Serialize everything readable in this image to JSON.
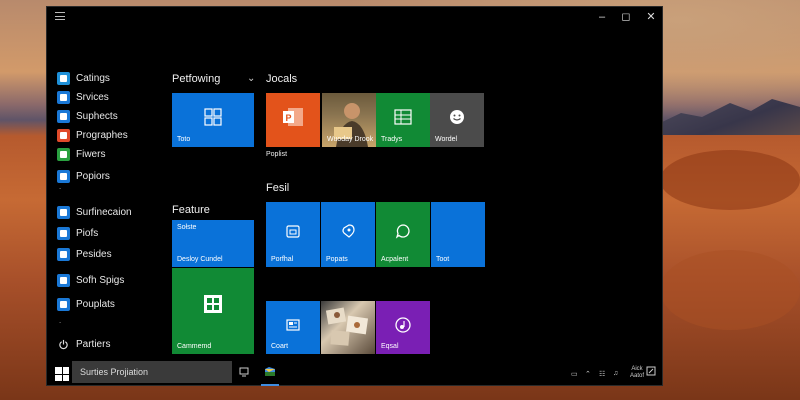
{
  "colors": {
    "tile_blue": "#0a72d9",
    "tile_orange": "#e3531b",
    "tile_green": "#118a35",
    "tile_gray": "#4b4b4b",
    "tile_purple": "#7a1fb4",
    "search_bg": "#3a3a3a"
  },
  "window": {
    "menu_icon": "hamburger-icon",
    "controls": [
      "minimize",
      "maximize",
      "close"
    ]
  },
  "sidebar": {
    "items": [
      {
        "label": "Catings",
        "icon": "app-icon",
        "color": "#1e90d8"
      },
      {
        "label": "Srvices",
        "icon": "app-icon",
        "color": "#1a78d6"
      },
      {
        "label": "Suphects",
        "icon": "app-icon",
        "color": "#1a78d6"
      },
      {
        "label": "Prographes",
        "icon": "app-icon",
        "color": "#e04a2a"
      },
      {
        "label": "Fiwers",
        "icon": "app-icon",
        "color": "#2aa040"
      },
      {
        "label": "Popiors",
        "icon": "app-icon",
        "color": "#1a78d6"
      },
      {
        "label": "Surfinecaion",
        "icon": "app-icon",
        "color": "#1a78d6"
      },
      {
        "label": "Piofs",
        "icon": "app-icon",
        "color": "#1a78d6"
      },
      {
        "label": "Pesides",
        "icon": "app-icon",
        "color": "#1a78d6"
      },
      {
        "label": "Sofh Spigs",
        "icon": "app-icon",
        "color": "#1a78d6"
      },
      {
        "label": "Pouplats",
        "icon": "app-icon",
        "color": "#1a78d6"
      },
      {
        "label": "Partiers",
        "icon": "power-icon",
        "color": "#000000"
      }
    ]
  },
  "groups": {
    "petfowing": "Petfowing",
    "locals": "Jocals",
    "feature": "Feature",
    "fesil": "Fesil"
  },
  "tiles": {
    "toto": "Toto",
    "poplist": "Poplist",
    "woman": "Wuoday Drook",
    "trades": "Tradys",
    "wordel": "Wordel",
    "soste": "Sołste",
    "destop": "Desloy Cundel",
    "commend": "Cammemd",
    "porfhal": "Porfhal",
    "popats": "Popats",
    "acpalent": "Acpalent",
    "toot": "Toot",
    "coart": "Coart",
    "eqsal": "Eqsal"
  },
  "taskbar": {
    "search_text": "Surties Projiation",
    "clock_line1": "Aick",
    "clock_line2": "Aatof"
  }
}
